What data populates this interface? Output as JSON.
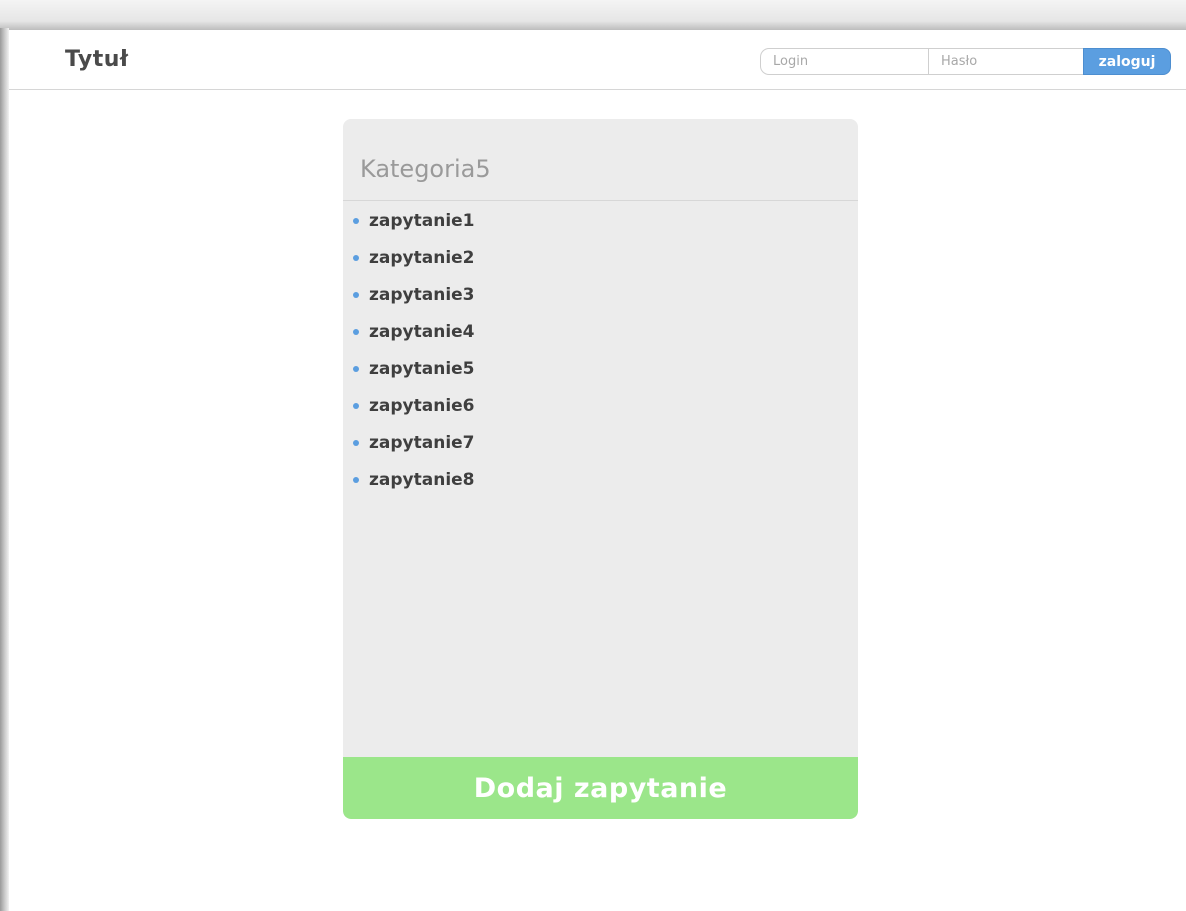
{
  "header": {
    "title": "Tytuł",
    "login_placeholder": "Login",
    "password_placeholder": "Hasło",
    "login_button": "zaloguj"
  },
  "category": {
    "title": "Kategoria5",
    "queries": [
      "zapytanie1",
      "zapytanie2",
      "zapytanie3",
      "zapytanie4",
      "zapytanie5",
      "zapytanie6",
      "zapytanie7",
      "zapytanie8"
    ],
    "add_button": "Dodaj zapytanie"
  },
  "colors": {
    "accent_blue": "#5b9ee0",
    "add_green": "#9be68a",
    "card_bg": "#ececec"
  }
}
